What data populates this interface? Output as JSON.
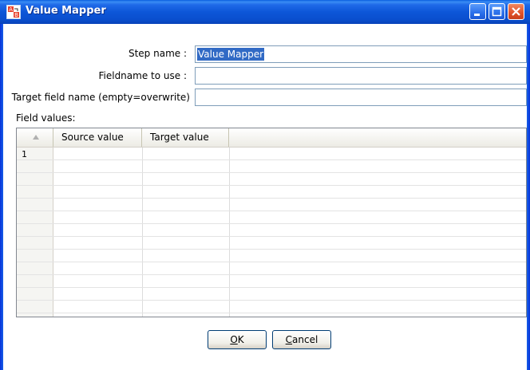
{
  "window": {
    "title": "Value Mapper",
    "icon": "value-mapper-app-icon"
  },
  "form": {
    "step_name_label": "Step name :",
    "step_name_value": "Value Mapper",
    "fieldname_label": "Fieldname to use :",
    "fieldname_value": "",
    "target_field_label": "Target field name (empty=overwrite)",
    "target_field_value": ""
  },
  "table": {
    "section_label": "Field values:",
    "columns": [
      "Source value",
      "Target value"
    ],
    "rows": [
      {
        "num": "1",
        "source": "",
        "target": ""
      }
    ]
  },
  "buttons": {
    "ok_mnemonic": "O",
    "ok_rest": "K",
    "cancel_mnemonic": "C",
    "cancel_rest": "ancel"
  },
  "colors": {
    "titlebar": "#0a4fcf",
    "selection": "#316ac5",
    "close_button": "#e0522a"
  }
}
